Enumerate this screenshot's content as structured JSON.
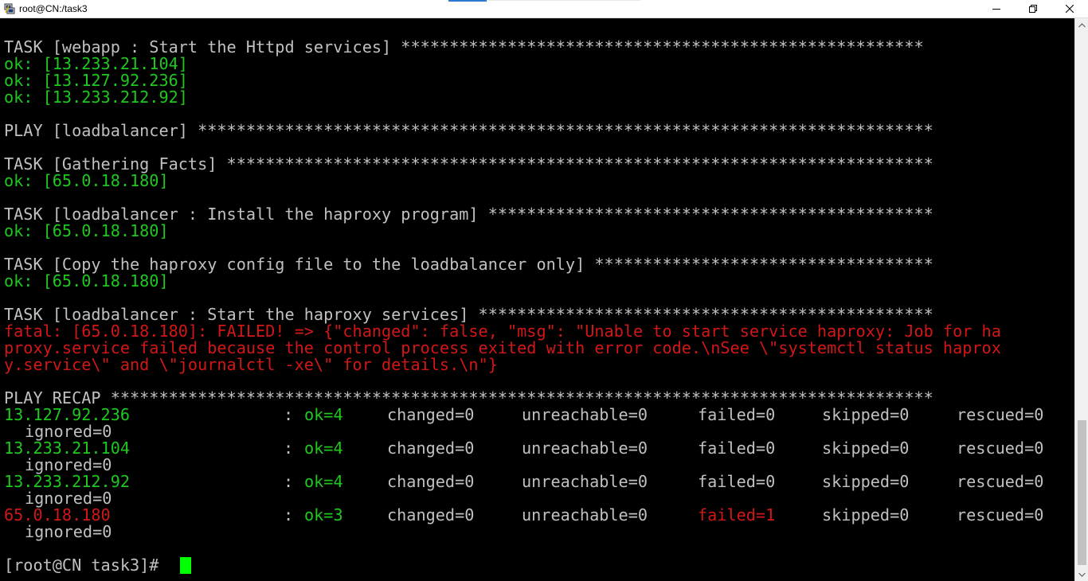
{
  "window": {
    "title": "root@CN:/task3",
    "icon": "putty-terminal-icon"
  },
  "colors": {
    "terminal_bg": "#000000",
    "text_default": "#c0c0c0",
    "text_ok": "#1fc81f",
    "text_fatal": "#d11717",
    "cursor": "#00ff00"
  },
  "output": {
    "task_start_httpd": "TASK [webapp : Start the Httpd services] ******************************************************",
    "ok_1": "ok: [13.233.21.104]",
    "ok_2": "ok: [13.127.92.236]",
    "ok_3": "ok: [13.233.212.92]",
    "play_loadbalancer": "PLAY [loadbalancer] ****************************************************************************",
    "task_gathering": "TASK [Gathering Facts] *************************************************************************",
    "ok_lb_1": "ok: [65.0.18.180]",
    "task_install_haproxy": "TASK [loadbalancer : Install the haproxy program] **********************************************",
    "ok_lb_2": "ok: [65.0.18.180]",
    "task_copy_config": "TASK [Copy the haproxy config file to the loadbalancer only] ***********************************",
    "ok_lb_3": "ok: [65.0.18.180]",
    "task_start_haproxy": "TASK [loadbalancer : Start the haproxy services] ***********************************************",
    "fatal_1": "fatal: [65.0.18.180]: FAILED! => {\"changed\": false, \"msg\": \"Unable to start service haproxy: Job for ha",
    "fatal_2": "proxy.service failed because the control process exited with error code.\\nSee \\\"systemctl status haprox",
    "fatal_3": "y.service\\\" and \\\"journalctl -xe\\\" for details.\\n\"}",
    "play_recap": "PLAY RECAP *************************************************************************************"
  },
  "recap": [
    {
      "host": "13.127.92.236",
      "ok": "ok=4",
      "changed": "changed=0",
      "unreachable": "unreachable=0",
      "failed": "failed=0",
      "skipped": "skipped=0",
      "rescued": "rescued=0",
      "ignored": "ignored=0",
      "status": "ok"
    },
    {
      "host": "13.233.21.104",
      "ok": "ok=4",
      "changed": "changed=0",
      "unreachable": "unreachable=0",
      "failed": "failed=0",
      "skipped": "skipped=0",
      "rescued": "rescued=0",
      "ignored": "ignored=0",
      "status": "ok"
    },
    {
      "host": "13.233.212.92",
      "ok": "ok=4",
      "changed": "changed=0",
      "unreachable": "unreachable=0",
      "failed": "failed=0",
      "skipped": "skipped=0",
      "rescued": "rescued=0",
      "ignored": "ignored=0",
      "status": "ok"
    },
    {
      "host": "65.0.18.180",
      "ok": "ok=3",
      "changed": "changed=0",
      "unreachable": "unreachable=0",
      "failed": "failed=1",
      "skipped": "skipped=0",
      "rescued": "rescued=0",
      "ignored": "ignored=0",
      "status": "failed"
    }
  ],
  "recap_separator": ":",
  "prompt": "[root@CN task3]# "
}
